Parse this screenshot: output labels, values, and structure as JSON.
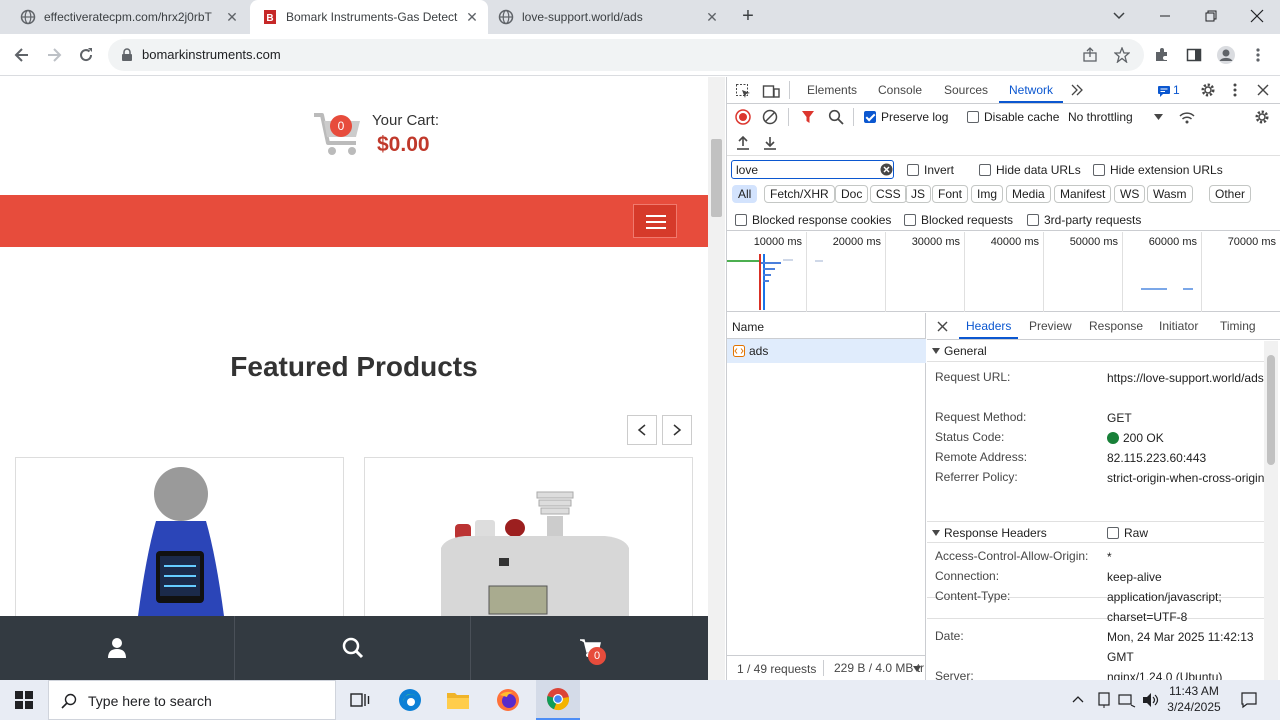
{
  "browser": {
    "tabs": [
      {
        "title": "effectiveratecpm.com/hrx2j0rbT",
        "active": false
      },
      {
        "title": "Bomark Instruments-Gas Detect",
        "active": true
      },
      {
        "title": "love-support.world/ads",
        "active": false
      }
    ],
    "url": "bomarkinstruments.com"
  },
  "site": {
    "cart_count": "0",
    "cart_label": "Your Cart:",
    "cart_total": "$0.00",
    "featured_heading": "Featured Products",
    "bottom_cart_count": "0",
    "accent_color": "#e74c3c"
  },
  "devtools": {
    "tabs": [
      "Elements",
      "Console",
      "Sources",
      "Network"
    ],
    "active_tab": "Network",
    "issues_count": "1",
    "preserve_log_label": "Preserve log",
    "disable_cache_label": "Disable cache",
    "throttling": "No throttling",
    "filter_value": "love",
    "invert_label": "Invert",
    "hide_data_urls_label": "Hide data URLs",
    "hide_extension_urls_label": "Hide extension URLs",
    "type_filters": [
      "All",
      "Fetch/XHR",
      "Doc",
      "CSS",
      "JS",
      "Font",
      "Img",
      "Media",
      "Manifest",
      "WS",
      "Wasm",
      "Other"
    ],
    "blocked_response_cookies_label": "Blocked response cookies",
    "blocked_requests_label": "Blocked requests",
    "third_party_label": "3rd-party requests",
    "timeline_ticks": [
      "10000 ms",
      "20000 ms",
      "30000 ms",
      "40000 ms",
      "50000 ms",
      "60000 ms",
      "70000 ms"
    ],
    "name_header": "Name",
    "request_name": "ads",
    "detail_tabs": [
      "Headers",
      "Preview",
      "Response",
      "Initiator",
      "Timing"
    ],
    "general_title": "General",
    "general": [
      {
        "key": "Request URL:",
        "value": "https://love-support.world/ads"
      },
      {
        "key": "Request Method:",
        "value": "GET"
      },
      {
        "key": "Status Code:",
        "value": "200 OK"
      },
      {
        "key": "Remote Address:",
        "value": "82.115.223.60:443"
      },
      {
        "key": "Referrer Policy:",
        "value": "strict-origin-when-cross-origin"
      }
    ],
    "response_headers_title": "Response Headers",
    "raw_label": "Raw",
    "response_headers": [
      {
        "key": "Access-Control-Allow-Origin:",
        "value": "*"
      },
      {
        "key": "Connection:",
        "value": "keep-alive"
      },
      {
        "key": "Content-Type:",
        "value": "application/javascript; charset=UTF-8"
      },
      {
        "key": "Date:",
        "value": "Mon, 24 Mar 2025 11:42:13 GMT"
      },
      {
        "key": "Server:",
        "value": "nginx/1.24.0 (Ubuntu)"
      }
    ],
    "status_bar_requests": "1 / 49 requests",
    "status_bar_transferred": "229 B / 4.0 MB tr"
  },
  "taskbar": {
    "search_placeholder": "Type here to search",
    "time": "11:43 AM",
    "date": "3/24/2025"
  }
}
